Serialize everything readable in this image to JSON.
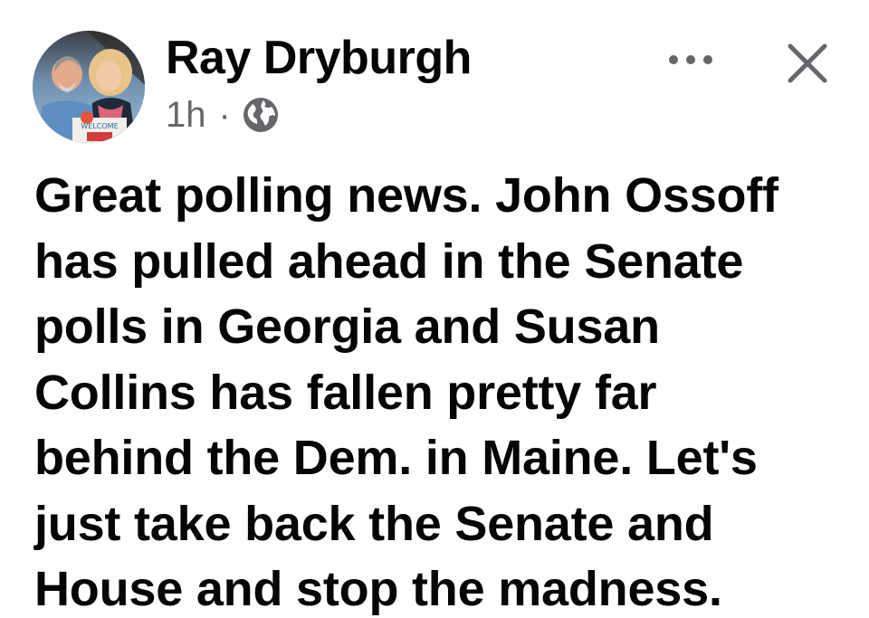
{
  "post": {
    "author": {
      "name": "Ray Dryburgh",
      "avatar_sign_text": "WELCOME"
    },
    "timestamp": "1h",
    "separator": "·",
    "privacy_icon": "globe-icon",
    "actions": {
      "more_icon": "more-options-icon",
      "close_icon": "close-icon"
    },
    "text_lines": [
      "Great polling news. John Ossoff",
      "has pulled ahead in the Senate",
      "polls in Georgia and Susan",
      "Collins has fallen pretty far",
      "behind the Dem. in Maine. Let's",
      "just take back the Senate and",
      "House and stop the madness."
    ]
  },
  "colors": {
    "text_primary": "#050505",
    "text_secondary": "#65676b",
    "background": "#ffffff"
  }
}
